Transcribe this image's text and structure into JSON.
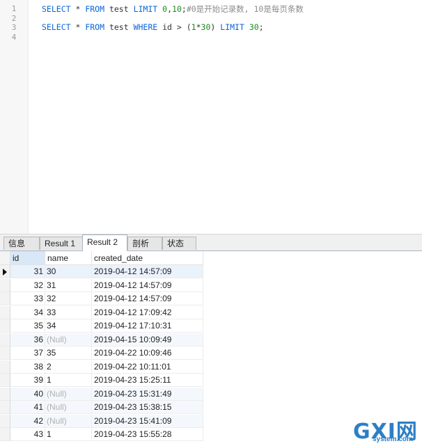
{
  "editor": {
    "lines": [
      {
        "num": "1",
        "code": [
          {
            "t": "SELECT",
            "k": "kw"
          },
          {
            "t": " * ",
            "k": "op"
          },
          {
            "t": "FROM",
            "k": "kw"
          },
          {
            "t": " test ",
            "k": "op"
          },
          {
            "t": "LIMIT",
            "k": "kw"
          },
          {
            "t": " ",
            "k": "op"
          },
          {
            "t": "0",
            "k": "num"
          },
          {
            "t": ",",
            "k": "op"
          },
          {
            "t": "10",
            "k": "num"
          },
          {
            "t": ";",
            "k": "op"
          },
          {
            "t": "#0是开始记录数, 10是每页条数",
            "k": "cmt"
          }
        ]
      },
      {
        "num": "2",
        "code": []
      },
      {
        "num": "3",
        "code": [
          {
            "t": "SELECT",
            "k": "kw"
          },
          {
            "t": " * ",
            "k": "op"
          },
          {
            "t": "FROM",
            "k": "kw"
          },
          {
            "t": " test ",
            "k": "op"
          },
          {
            "t": "WHERE",
            "k": "kw"
          },
          {
            "t": " id > (",
            "k": "op"
          },
          {
            "t": "1",
            "k": "num"
          },
          {
            "t": "*",
            "k": "op"
          },
          {
            "t": "30",
            "k": "num"
          },
          {
            "t": ") ",
            "k": "op"
          },
          {
            "t": "LIMIT",
            "k": "kw"
          },
          {
            "t": " ",
            "k": "op"
          },
          {
            "t": "30",
            "k": "num"
          },
          {
            "t": ";",
            "k": "op"
          }
        ]
      },
      {
        "num": "4",
        "code": []
      }
    ]
  },
  "tabs": {
    "info": "信息",
    "result1": "Result 1",
    "result2": "Result 2",
    "profile": "剖析",
    "status": "状态"
  },
  "grid": {
    "columns": {
      "id": "id",
      "name": "name",
      "created_date": "created_date"
    },
    "rows": [
      {
        "id": "31",
        "name": "30",
        "date": "2019-04-12 14:57:09",
        "null": false
      },
      {
        "id": "32",
        "name": "31",
        "date": "2019-04-12 14:57:09",
        "null": false
      },
      {
        "id": "33",
        "name": "32",
        "date": "2019-04-12 14:57:09",
        "null": false
      },
      {
        "id": "34",
        "name": "33",
        "date": "2019-04-12 17:09:42",
        "null": false
      },
      {
        "id": "35",
        "name": "34",
        "date": "2019-04-12 17:10:31",
        "null": false
      },
      {
        "id": "36",
        "name": "(Null)",
        "date": "2019-04-15 10:09:49",
        "null": true
      },
      {
        "id": "37",
        "name": "35",
        "date": "2019-04-22 10:09:46",
        "null": false
      },
      {
        "id": "38",
        "name": "2",
        "date": "2019-04-22 10:11:01",
        "null": false
      },
      {
        "id": "39",
        "name": "1",
        "date": "2019-04-23 15:25:11",
        "null": false
      },
      {
        "id": "40",
        "name": "(Null)",
        "date": "2019-04-23 15:31:49",
        "null": true
      },
      {
        "id": "41",
        "name": "(Null)",
        "date": "2019-04-23 15:38:15",
        "null": true
      },
      {
        "id": "42",
        "name": "(Null)",
        "date": "2019-04-23 15:41:09",
        "null": true
      },
      {
        "id": "43",
        "name": "1",
        "date": "2019-04-23 15:55:28",
        "null": false
      }
    ]
  },
  "watermark": {
    "brand": "GXI网",
    "site": "system.com"
  }
}
